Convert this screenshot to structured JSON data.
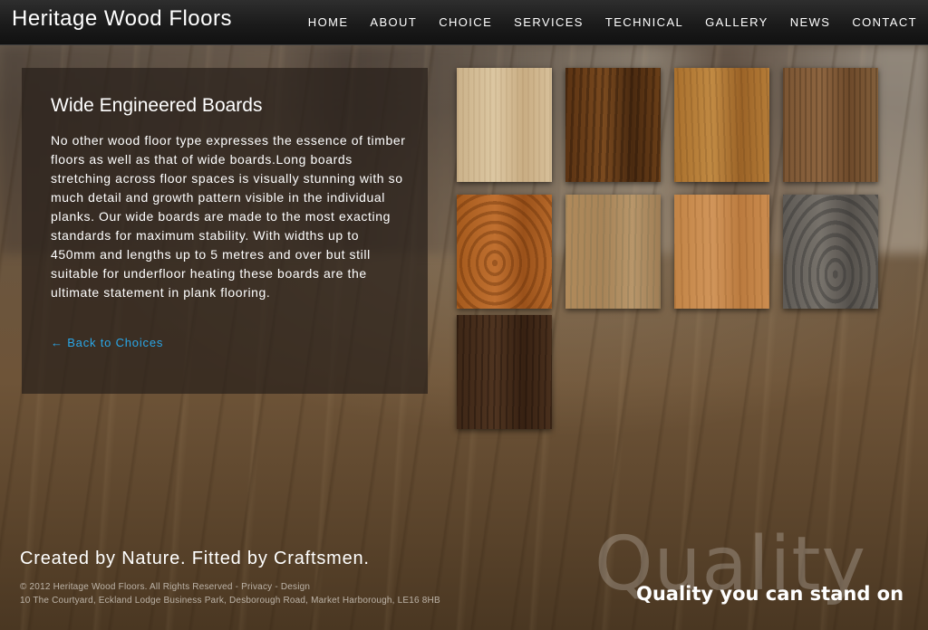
{
  "site": {
    "logo": "Heritage Wood Floors"
  },
  "nav": {
    "items": [
      {
        "label": "HOME"
      },
      {
        "label": "ABOUT"
      },
      {
        "label": "CHOICE"
      },
      {
        "label": "SERVICES"
      },
      {
        "label": "TECHNICAL"
      },
      {
        "label": "GALLERY"
      },
      {
        "label": "NEWS"
      },
      {
        "label": "CONTACT"
      }
    ]
  },
  "content": {
    "title": "Wide Engineered Boards",
    "body": "No other wood floor type expresses the essence of timber floors as well as that of wide boards.Long boards stretching across floor spaces is visually stunning with so much detail and growth pattern visible in the individual planks. Our wide boards are made to the most exacting standards for maximum stability. With widths up to 450mm and lengths up to 5 metres and over but still suitable for underfloor heating these boards are the ultimate statement in plank flooring.",
    "back_link": "← Back to Choices"
  },
  "footer": {
    "slogan": "Created by Nature. Fitted by Craftsmen.",
    "copyright": "© 2012 Heritage Wood Floors. All Rights Reserved - ",
    "privacy": "Privacy",
    "sep": " - ",
    "design": "Design",
    "address": "10 The Courtyard, Eckland Lodge Business Park, Desborough Road, Market Harborough, LE16 8HB",
    "quality_big": "Quality",
    "quality_tag": "Quality you can stand on"
  },
  "colors": {
    "link": "#2aa7e8",
    "header_bg": "#1b1b1b"
  }
}
